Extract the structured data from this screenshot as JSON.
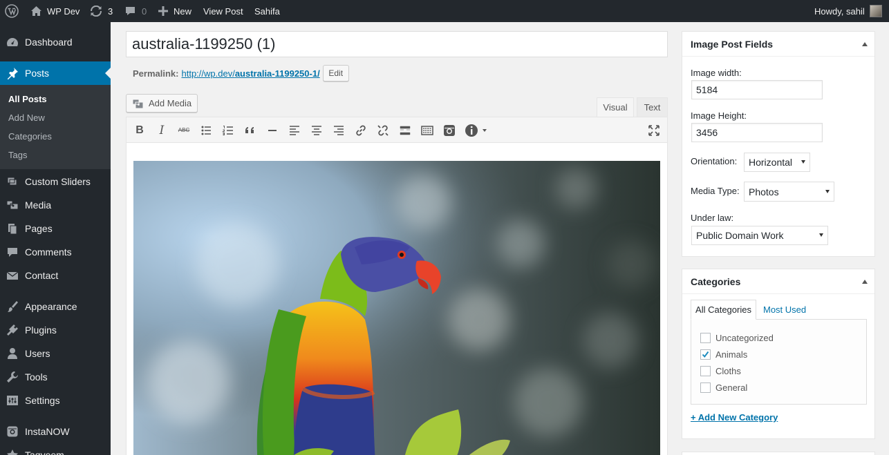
{
  "adminbar": {
    "site_name": "WP Dev",
    "updates_count": "3",
    "comments_count": "0",
    "new_label": "New",
    "view_post_label": "View Post",
    "theme_label": "Sahifa",
    "howdy": "Howdy, sahil"
  },
  "sidebar": {
    "items": [
      {
        "label": "Dashboard",
        "icon": "dashboard-icon"
      },
      {
        "label": "Posts",
        "icon": "pin-icon"
      },
      {
        "label": "Custom Sliders",
        "icon": "sliders-icon"
      },
      {
        "label": "Media",
        "icon": "media-icon"
      },
      {
        "label": "Pages",
        "icon": "pages-icon"
      },
      {
        "label": "Comments",
        "icon": "comment-icon"
      },
      {
        "label": "Contact",
        "icon": "mail-icon"
      },
      {
        "label": "Appearance",
        "icon": "brush-icon"
      },
      {
        "label": "Plugins",
        "icon": "plug-icon"
      },
      {
        "label": "Users",
        "icon": "user-icon"
      },
      {
        "label": "Tools",
        "icon": "wrench-icon"
      },
      {
        "label": "Settings",
        "icon": "settings-icon"
      },
      {
        "label": "InstaNOW",
        "icon": "instagram-icon"
      },
      {
        "label": "Taqyeem",
        "icon": "star-icon"
      }
    ],
    "submenu": [
      "All Posts",
      "Add New",
      "Categories",
      "Tags"
    ]
  },
  "post": {
    "title": "australia-1199250 (1)",
    "permalink_label": "Permalink:",
    "permalink_base": "http://wp.dev/",
    "permalink_slug": "australia-1199250-1/",
    "edit_label": "Edit",
    "add_media_label": "Add Media",
    "tab_visual": "Visual",
    "tab_text": "Text"
  },
  "image_fields": {
    "title": "Image Post Fields",
    "width_label": "Image width:",
    "width_value": "5184",
    "height_label": "Image Height:",
    "height_value": "3456",
    "orientation_label": "Orientation:",
    "orientation_value": "Horizontal",
    "media_type_label": "Media Type:",
    "media_type_value": "Photos",
    "law_label": "Under law:",
    "law_value": "Public Domain Work"
  },
  "categories": {
    "title": "Categories",
    "tab_all": "All Categories",
    "tab_used": "Most Used",
    "items": [
      {
        "label": "Uncategorized",
        "checked": false
      },
      {
        "label": "Animals",
        "checked": true
      },
      {
        "label": "Cloths",
        "checked": false
      },
      {
        "label": "General",
        "checked": false
      }
    ],
    "add_new_label": "+ Add New Category"
  },
  "colors": {
    "adminbar_bg": "#23282d",
    "menu_active": "#0073aa",
    "link": "#0073aa"
  }
}
